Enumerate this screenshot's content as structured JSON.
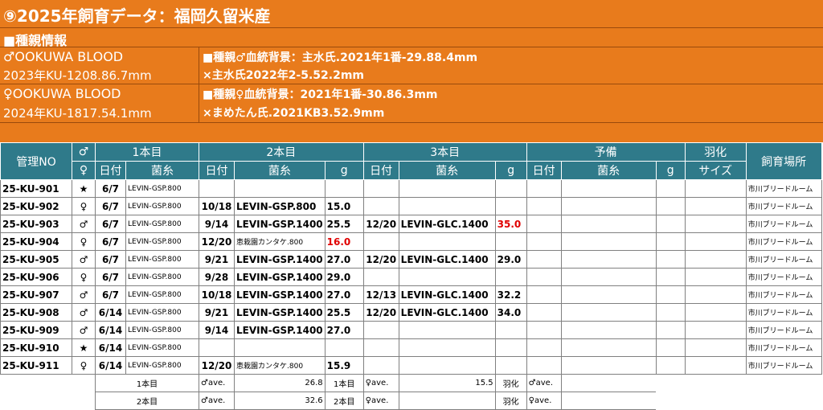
{
  "header": {
    "title": "⑨2025年飼育データ：福岡久留米産",
    "section": "■種親情報",
    "male_name": "♂OOKUWA BLOOD",
    "male_id": "2023年KU-1208.86.7mm",
    "male_line1": "■種親♂血統背景：主水氏.2021年1番-29.88.4mm",
    "male_line2": "×主水氏2022年2-5.52.2mm",
    "female_name": "♀OOKUWA BLOOD",
    "female_id": "2024年KU-1817.54.1mm",
    "female_line1": "■種親♀血統背景：2021年1番-30.86.3mm",
    "female_line2": "×まめたん氏.2021KB3.52.9mm"
  },
  "columns": {
    "kanri": "管理NO",
    "male": "♂",
    "female": "♀",
    "first": "1本目",
    "second": "2本目",
    "third": "3本目",
    "spare": "予備",
    "uka": "羽化",
    "place": "飼育場所",
    "date": "日付",
    "kinshi": "菌糸",
    "g": "g",
    "size": "サイズ"
  },
  "rows": [
    {
      "id": "25-KU-901",
      "sex": "★",
      "d1": "6/7",
      "k1": "LEVIN-GSP.800",
      "d2": "",
      "k2": "",
      "g2": "",
      "d3": "",
      "k3": "",
      "g3": "",
      "place": "市川ブリードルーム"
    },
    {
      "id": "25-KU-902",
      "sex": "♀",
      "d1": "6/7",
      "k1": "LEVIN-GSP.800",
      "d2": "10/18",
      "k2": "LEVIN-GSP.800",
      "g2": "15.0",
      "d3": "",
      "k3": "",
      "g3": "",
      "place": "市川ブリードルーム"
    },
    {
      "id": "25-KU-903",
      "sex": "♂",
      "d1": "6/7",
      "k1": "LEVIN-GSP.800",
      "d2": "9/14",
      "k2": "LEVIN-GSP.1400",
      "g2": "25.5",
      "d3": "12/20",
      "k3": "LEVIN-GLC.1400",
      "g3": "35.0",
      "place": "市川ブリードルーム"
    },
    {
      "id": "25-KU-904",
      "sex": "♀",
      "d1": "6/7",
      "k1": "LEVIN-GSP.800",
      "d2": "12/20",
      "k2": "恵栽園カンタケ.800",
      "g2": "16.0",
      "d3": "",
      "k3": "",
      "g3": "",
      "place": "市川ブリードルーム"
    },
    {
      "id": "25-KU-905",
      "sex": "♂",
      "d1": "6/7",
      "k1": "LEVIN-GSP.800",
      "d2": "9/21",
      "k2": "LEVIN-GSP.1400",
      "g2": "27.0",
      "d3": "12/20",
      "k3": "LEVIN-GLC.1400",
      "g3": "29.0",
      "place": "市川ブリードルーム"
    },
    {
      "id": "25-KU-906",
      "sex": "♀",
      "d1": "6/7",
      "k1": "LEVIN-GSP.800",
      "d2": "9/28",
      "k2": "LEVIN-GSP.1400",
      "g2": "29.0",
      "d3": "",
      "k3": "",
      "g3": "",
      "place": "市川ブリードルーム"
    },
    {
      "id": "25-KU-907",
      "sex": "♂",
      "d1": "6/7",
      "k1": "LEVIN-GSP.800",
      "d2": "10/18",
      "k2": "LEVIN-GSP.1400",
      "g2": "27.0",
      "d3": "12/13",
      "k3": "LEVIN-GLC.1400",
      "g3": "32.2",
      "place": "市川ブリードルーム"
    },
    {
      "id": "25-KU-908",
      "sex": "♂",
      "d1": "6/14",
      "k1": "LEVIN-GSP.800",
      "d2": "9/21",
      "k2": "LEVIN-GSP.1400",
      "g2": "25.5",
      "d3": "12/20",
      "k3": "LEVIN-GLC.1400",
      "g3": "34.0",
      "place": "市川ブリードルーム"
    },
    {
      "id": "25-KU-909",
      "sex": "♂",
      "d1": "6/14",
      "k1": "LEVIN-GSP.800",
      "d2": "9/14",
      "k2": "LEVIN-GSP.1400",
      "g2": "27.0",
      "d3": "",
      "k3": "",
      "g3": "",
      "place": "市川ブリードルーム"
    },
    {
      "id": "25-KU-910",
      "sex": "★",
      "d1": "6/14",
      "k1": "LEVIN-GSP.800",
      "d2": "",
      "k2": "",
      "g2": "",
      "d3": "",
      "k3": "",
      "g3": "",
      "place": "市川ブリードルーム"
    },
    {
      "id": "25-KU-911",
      "sex": "♀",
      "d1": "6/14",
      "k1": "LEVIN-GSP.800",
      "d2": "12/20",
      "k2": "恵栽園カンタケ.800",
      "g2": "15.9",
      "d3": "",
      "k3": "",
      "g3": "",
      "place": "市川ブリードルーム"
    }
  ],
  "summary": [
    {
      "label": "1本目",
      "male_ave": "♂ave.",
      "male_val": "26.8",
      "label2": "1本目",
      "female_ave": "♀ave.",
      "female_val": "15.5",
      "uka": "羽化",
      "uka_ave": "♂ave."
    },
    {
      "label": "2本目",
      "male_ave": "♂ave.",
      "male_val": "32.6",
      "label2": "2本目",
      "female_ave": "♀ave.",
      "female_val": "",
      "uka": "羽化",
      "uka_ave": "♀ave."
    }
  ],
  "colors": {
    "header_orange": "#E87B1C",
    "table_header": "#2F7A8A",
    "highlight_red": "#E00000"
  }
}
